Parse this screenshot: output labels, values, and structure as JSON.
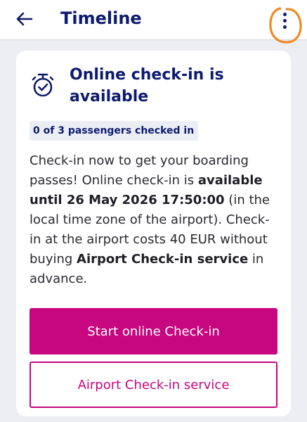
{
  "header": {
    "title": "Timeline",
    "back_icon": "arrow-left-icon",
    "menu_icon": "more-vertical-icon",
    "annotation_color": "#f08a24"
  },
  "checkin_card": {
    "icon": "stopwatch-check-icon",
    "heading": "Online check-in is available",
    "passengers_badge": "0 of 3 passengers checked in",
    "description": {
      "part1": "Check-in now to get your boarding passes! Online check-in is ",
      "bold1": "available until 26 May 2026 17:50:00",
      "part2": " (in the local time zone of the airport). Check-in at the airport costs 40 EUR without buying ",
      "bold2": "Airport Check-in service",
      "part3": " in advance."
    },
    "primary_button": "Start online Check-in",
    "secondary_button": "Airport Check-in service"
  },
  "colors": {
    "brand_navy": "#0d1b6e",
    "brand_magenta": "#c6077f",
    "background": "#edeef3"
  }
}
